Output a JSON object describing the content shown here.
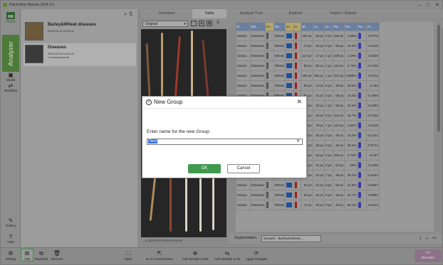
{
  "window": {
    "title": "PlantVision Breeze 2024.2.0",
    "minimize_glyph": "–",
    "maximize_glyph": "□",
    "close_glyph": "✕"
  },
  "leftnav": {
    "home_label": "Home",
    "analyzer_label": "Analyzer",
    "model_label": "Model",
    "workflow_label": "Workflow",
    "gallery_label": "Gallery",
    "help_label": "Help",
    "settings_label": "Setting"
  },
  "projects": [
    {
      "name": "Barley&Wheat diseases",
      "date": "2023-06-15 16:25:41",
      "sub": ""
    },
    {
      "name": "Diseases",
      "date": "2023-06-15 16:25:41",
      "sub": "1 measurements"
    }
  ],
  "tabs": [
    "Overview",
    "Table",
    "Analyse Tree",
    "Explore",
    "Import / Export"
  ],
  "active_tab": "Table",
  "toolbar": {
    "view_select": "Original"
  },
  "table": {
    "headers": [
      "B...",
      "Dis...",
      "Im...",
      "De...",
      "Im...",
      "In...",
      "Bl...",
      "Ar...",
      "Ar...",
      "Pe...",
      "Pe...",
      "Pe...",
      "Ar...",
      "Pe...",
      "La...",
      "Bl..."
    ],
    "rows": [
      [
        "Sampl...",
        "Diseases",
        "",
        "Wheat",
        "",
        "",
        "195 px",
        "89 px",
        "3 px",
        "196 px",
        "1.59%",
        "",
        "0.0778"
      ],
      [
        "Sampl...",
        "Diseases",
        "",
        "Wheat",
        "",
        "",
        "72 px",
        "23 px",
        "6 px",
        "80 px",
        "16.2%",
        "",
        "-0.1108"
      ],
      [
        "Sampl...",
        "Diseases",
        "",
        "Wheat",
        "",
        "",
        "117 px",
        "17 px",
        "1 px",
        "239 px",
        "1.09%",
        "",
        "0.2829"
      ],
      [
        "Sampl...",
        "Diseases",
        "",
        "Wheat",
        "",
        "",
        "80 px",
        "60 px",
        "2 px",
        "124 px",
        "2.74%",
        "",
        "-0.1755"
      ],
      [
        "Sampl...",
        "Diseases",
        "",
        "Wheat",
        "",
        "",
        "185 px",
        "185 px",
        "1 px",
        "372 px",
        "0.688%",
        "",
        "0.2713"
      ],
      [
        "Sampl...",
        "Diseases",
        "",
        "Wheat",
        "",
        "",
        "55 px",
        "13 px",
        "6 px",
        "38 px",
        "40.5%",
        "",
        "-0.163"
      ],
      [
        "Sampl...",
        "Diseases",
        "",
        "Wheat",
        "",
        "",
        "54 px",
        "24 px",
        "3 px",
        "56 px",
        "10.4%",
        "",
        "-0.1969"
      ],
      [
        "Sampl...",
        "Diseases",
        "",
        "Wheat",
        "",
        "",
        "69 px",
        "19 px",
        "4 px",
        "56 px",
        "22.3%",
        "",
        "-0.1003"
      ],
      [
        "Sampl...",
        "Diseases",
        "",
        "Wheat",
        "",
        "",
        "131 px",
        "29 px",
        "9 px",
        "104 px",
        "15.7%",
        "",
        "-0.1032"
      ],
      [
        "Sampl...",
        "Diseases",
        "",
        "Wheat",
        "",
        "",
        "70 px",
        "78 px",
        "1 px",
        "142 px",
        "1.82%",
        "",
        "0.2125"
      ],
      [
        "Sampl...",
        "Diseases",
        "",
        "Wheat",
        "",
        "",
        "70 px",
        "20 px",
        "3 px",
        "46 px",
        "15.2%",
        "",
        "-0.1221"
      ],
      [
        "Sampl...",
        "Diseases",
        "",
        "Wheat",
        "",
        "",
        "94 px",
        "18 px",
        "6 px",
        "46 px",
        "40.4%",
        "",
        "-0.0744"
      ],
      [
        "Sampl...",
        "Diseases",
        "",
        "Wheat",
        "",
        "",
        "246 px",
        "63 px",
        "4 px",
        "200 px",
        "2.73%",
        "",
        "-0.207"
      ],
      [
        "Sampl...",
        "Diseases",
        "",
        "Wheat",
        "",
        "",
        "88 px",
        "21 px",
        "8 px",
        "62 px",
        "26%",
        "",
        "-0.1188"
      ],
      [
        "Sampl...",
        "Diseases",
        "",
        "Wheat",
        "",
        "",
        "132 px",
        "22 px",
        "7 px",
        "38 px",
        "35.2%",
        "",
        "-0.0434"
      ],
      [
        "Sampl...",
        "Diseases",
        "",
        "Wheat",
        "",
        "",
        "91 px",
        "22 px",
        "6 px",
        "56 px",
        "21.8%",
        "",
        "-0.0567"
      ],
      [
        "Sampl...",
        "Diseases",
        "",
        "Wheat",
        "",
        "",
        "92 px",
        "22 px",
        "5 px",
        "36 px",
        "21.7%",
        "",
        "-0.0881"
      ],
      [
        "Sampl...",
        "Diseases",
        "",
        "Wheat",
        "",
        "",
        "71 px",
        "20 px",
        "9 px",
        "40 px",
        "50.1%",
        "",
        "-0.0613"
      ]
    ]
  },
  "segmentation": {
    "label": "Segmentation",
    "value": "Sample - Barley&Wheat..."
  },
  "selected_measurements_label": "Selected Measurements",
  "bottombar": {
    "add_label": "Add",
    "duplicate_label": "Duplicate",
    "remove_label": "Remove",
    "open_label": "Open",
    "goto_label": "Go to measuremen",
    "add_sample_label": "Add Sample mode",
    "add_variable_label": "Add Variable or Bl",
    "apply_label": "Apply Changes",
    "record_label": "Recorder"
  },
  "dialog": {
    "title": "New Group",
    "prompt": "Enter name for the new Group:",
    "input_value": "Test",
    "ok_label": "OK",
    "cancel_label": "Cancel"
  },
  "colors": {
    "accent_green": "#3f9a4d",
    "selection_blue": "#2f6fd6",
    "header_blue": "#6a7fa0"
  }
}
